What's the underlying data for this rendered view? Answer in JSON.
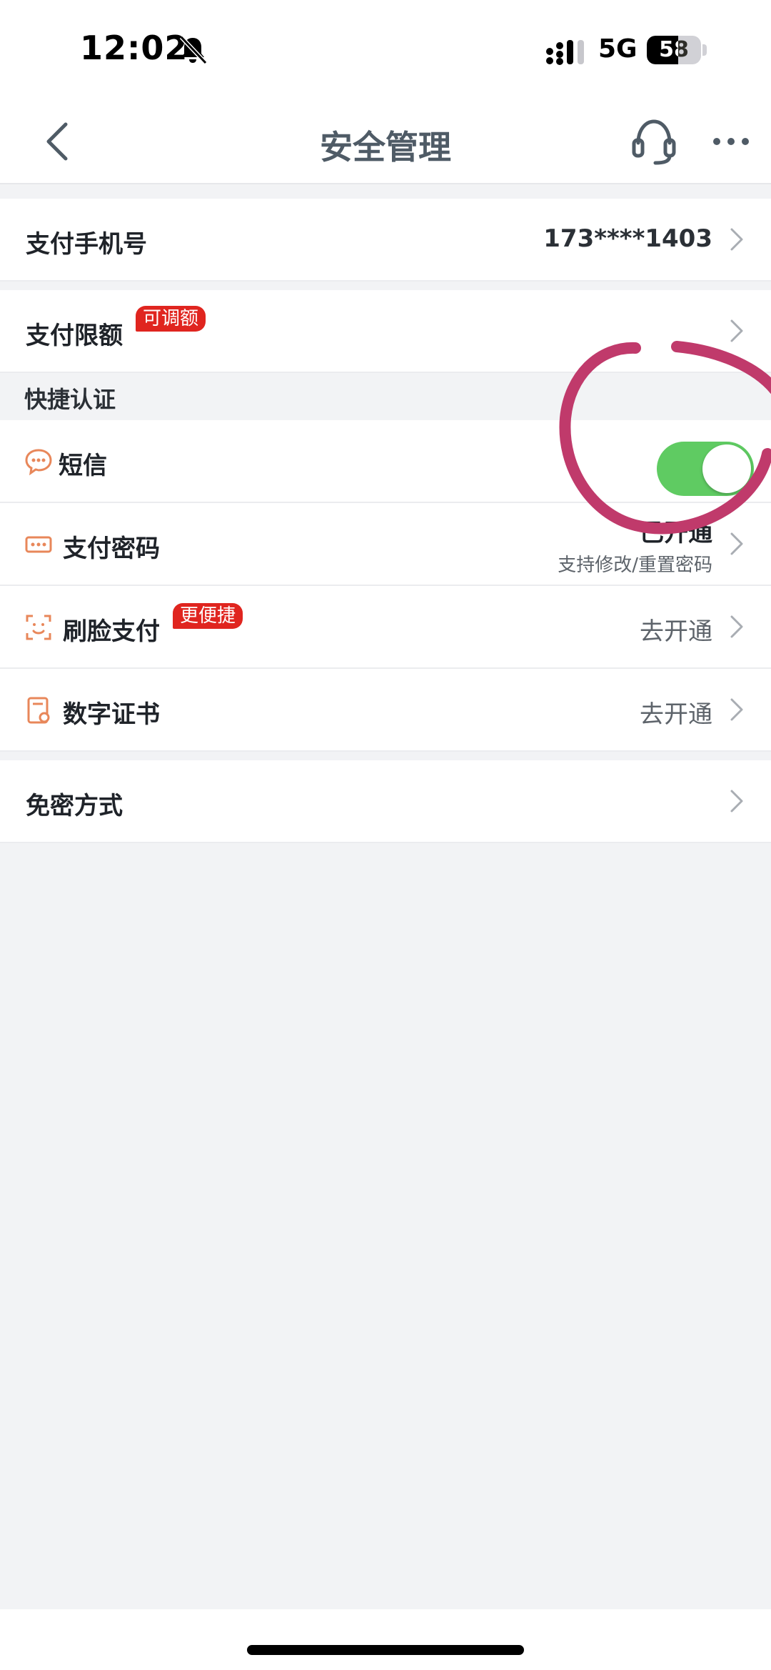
{
  "status_bar": {
    "time": "12:02",
    "network": "5G",
    "battery_level": "58",
    "battery_fraction": 0.58,
    "icons": [
      "bell-muted-icon",
      "signal-icon",
      "battery-icon"
    ]
  },
  "navbar": {
    "title": "安全管理",
    "icons": [
      "back-icon",
      "headset-icon",
      "more-icon"
    ]
  },
  "rows": {
    "payment_phone": {
      "label": "支付手机号",
      "value": "173****1403"
    },
    "payment_limit": {
      "label": "支付限额",
      "badge": "可调额"
    },
    "section_quick_auth": "快捷认证",
    "sms": {
      "label": "短信",
      "icon": "message-icon",
      "enabled": true
    },
    "payment_password": {
      "label": "支付密码",
      "icon": "password-icon",
      "value": "已开通",
      "subvalue": "支持修改/重置密码"
    },
    "face_pay": {
      "label": "刷脸支付",
      "icon": "face-scan-icon",
      "badge": "更便捷",
      "value": "去开通"
    },
    "digital_cert": {
      "label": "数字证书",
      "icon": "certificate-icon",
      "value": "去开通"
    },
    "password_free": {
      "label": "免密方式"
    }
  },
  "colors": {
    "accent_red": "#e0251f",
    "toggle_on": "#5fcb62",
    "annotation": "#c03a6b",
    "icon_orange": "#e8875a"
  }
}
